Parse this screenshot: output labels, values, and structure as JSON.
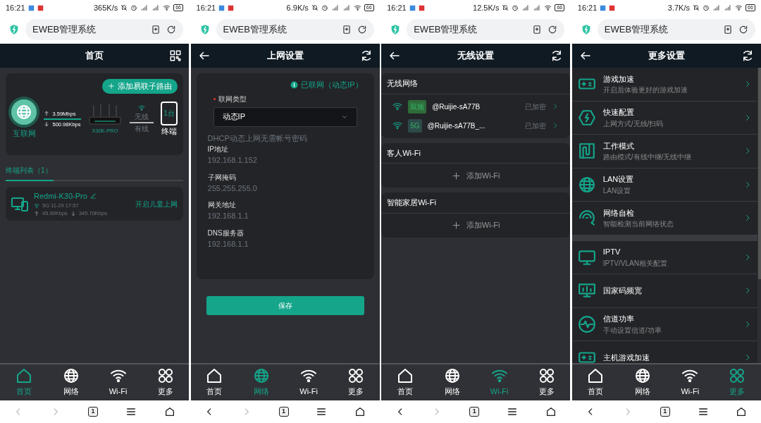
{
  "phones": [
    {
      "status_bar": {
        "time": "16:21",
        "speed": "365K/s",
        "battery": "66"
      },
      "browser": {
        "title": "EWEB管理系统"
      },
      "header": {
        "title": "首页",
        "back": false,
        "qr": true
      },
      "content": {
        "kind": "home",
        "add_button": "添加易联子路由",
        "internet": "互联网",
        "upload": "3.59Mbps",
        "download": "500.98Kbps",
        "router": "X30E-PRO",
        "wireless": "无线",
        "wired": "有线",
        "terminal_count": "1台",
        "terminal": "终端",
        "list_title": "终端列表（1）",
        "device": {
          "name": "Redmi-K30-Pro",
          "band": "5G 11-29 17:57",
          "upload": "45.90Kbps",
          "download": "345.70Kbps",
          "action": "开启儿童上网"
        }
      },
      "tabbar": [
        {
          "label": "首页",
          "selected": true
        },
        {
          "label": "网络",
          "selected": false
        },
        {
          "label": "Wi-Fi",
          "selected": false
        },
        {
          "label": "更多",
          "selected": false
        }
      ],
      "nav": {
        "back_enabled": false,
        "tabs": "1"
      }
    },
    {
      "status_bar": {
        "time": "16:21",
        "speed": "6.9K/s",
        "battery": "66"
      },
      "browser": {
        "title": "EWEB管理系统"
      },
      "header": {
        "title": "上网设置",
        "back": true,
        "refresh": true
      },
      "content": {
        "kind": "network",
        "status": "已联网（动态IP）",
        "field_label": "联网类型",
        "required": true,
        "select_value": "动态IP",
        "hint": "DHCP动态上网无需帐号密码",
        "info": [
          {
            "label": "IP地址",
            "value": "192.168.1.152"
          },
          {
            "label": "子网掩码",
            "value": "255.255.255.0"
          },
          {
            "label": "网关地址",
            "value": "192.168.1.1"
          },
          {
            "label": "DNS服务器",
            "value": "192.168.1.1"
          }
        ],
        "save": "保存"
      },
      "tabbar": [
        {
          "label": "首页",
          "selected": false
        },
        {
          "label": "网络",
          "selected": true
        },
        {
          "label": "Wi-Fi",
          "selected": false
        },
        {
          "label": "更多",
          "selected": false
        }
      ],
      "nav": {
        "back_enabled": true,
        "tabs": "1"
      }
    },
    {
      "status_bar": {
        "time": "16:21",
        "speed": "12.5K/s",
        "battery": "66"
      },
      "browser": {
        "title": "EWEB管理系统"
      },
      "header": {
        "title": "无线设置",
        "back": true,
        "refresh": true
      },
      "content": {
        "kind": "wifi",
        "sections": [
          {
            "title": "无线网络",
            "networks": [
              {
                "band": "双频",
                "color": "#2f6b3a",
                "ssid": "@Ruijie-sA77B",
                "status": "已加密"
              },
              {
                "band": "5G",
                "color": "#2c4a48",
                "ssid": "@Ruijie-sA77B_...",
                "status": "已加密"
              }
            ]
          },
          {
            "title": "客人Wi-Fi",
            "add": "添加Wi-Fi"
          },
          {
            "title": "智能家居Wi-Fi",
            "add": "添加Wi-Fi"
          }
        ]
      },
      "tabbar": [
        {
          "label": "首页",
          "selected": false
        },
        {
          "label": "网络",
          "selected": false
        },
        {
          "label": "Wi-Fi",
          "selected": true
        },
        {
          "label": "更多",
          "selected": false
        }
      ],
      "nav": {
        "back_enabled": true,
        "tabs": "1"
      }
    },
    {
      "status_bar": {
        "time": "16:21",
        "speed": "3.7K/s",
        "battery": "66"
      },
      "browser": {
        "title": "EWEB管理系统"
      },
      "header": {
        "title": "更多设置",
        "back": true,
        "refresh": true
      },
      "content": {
        "kind": "more",
        "groups": [
          {
            "items": [
              {
                "title": "游戏加速",
                "subtitle": "开启后体验更好的游戏加速"
              },
              {
                "title": "快速配置",
                "subtitle": "上网方式/无线/扫码"
              },
              {
                "title": "工作模式",
                "subtitle": "路由模式/有线中继/无线中继"
              },
              {
                "title": "LAN设置",
                "subtitle": "LAN设置"
              },
              {
                "title": "网络自检",
                "subtitle": "智能检测当前网络状态"
              }
            ]
          },
          {
            "items": [
              {
                "title": "IPTV",
                "subtitle": "IPTV/VLAN相关配置"
              },
              {
                "title": "国家码频宽"
              },
              {
                "title": "信道功率",
                "subtitle": "手动设置信道/功率"
              },
              {
                "title": "主机游戏加速"
              }
            ]
          }
        ]
      },
      "tabbar": [
        {
          "label": "首页",
          "selected": false
        },
        {
          "label": "网络",
          "selected": false
        },
        {
          "label": "Wi-Fi",
          "selected": false
        },
        {
          "label": "更多",
          "selected": true
        }
      ],
      "nav": {
        "back_enabled": true,
        "tabs": "1"
      }
    }
  ]
}
